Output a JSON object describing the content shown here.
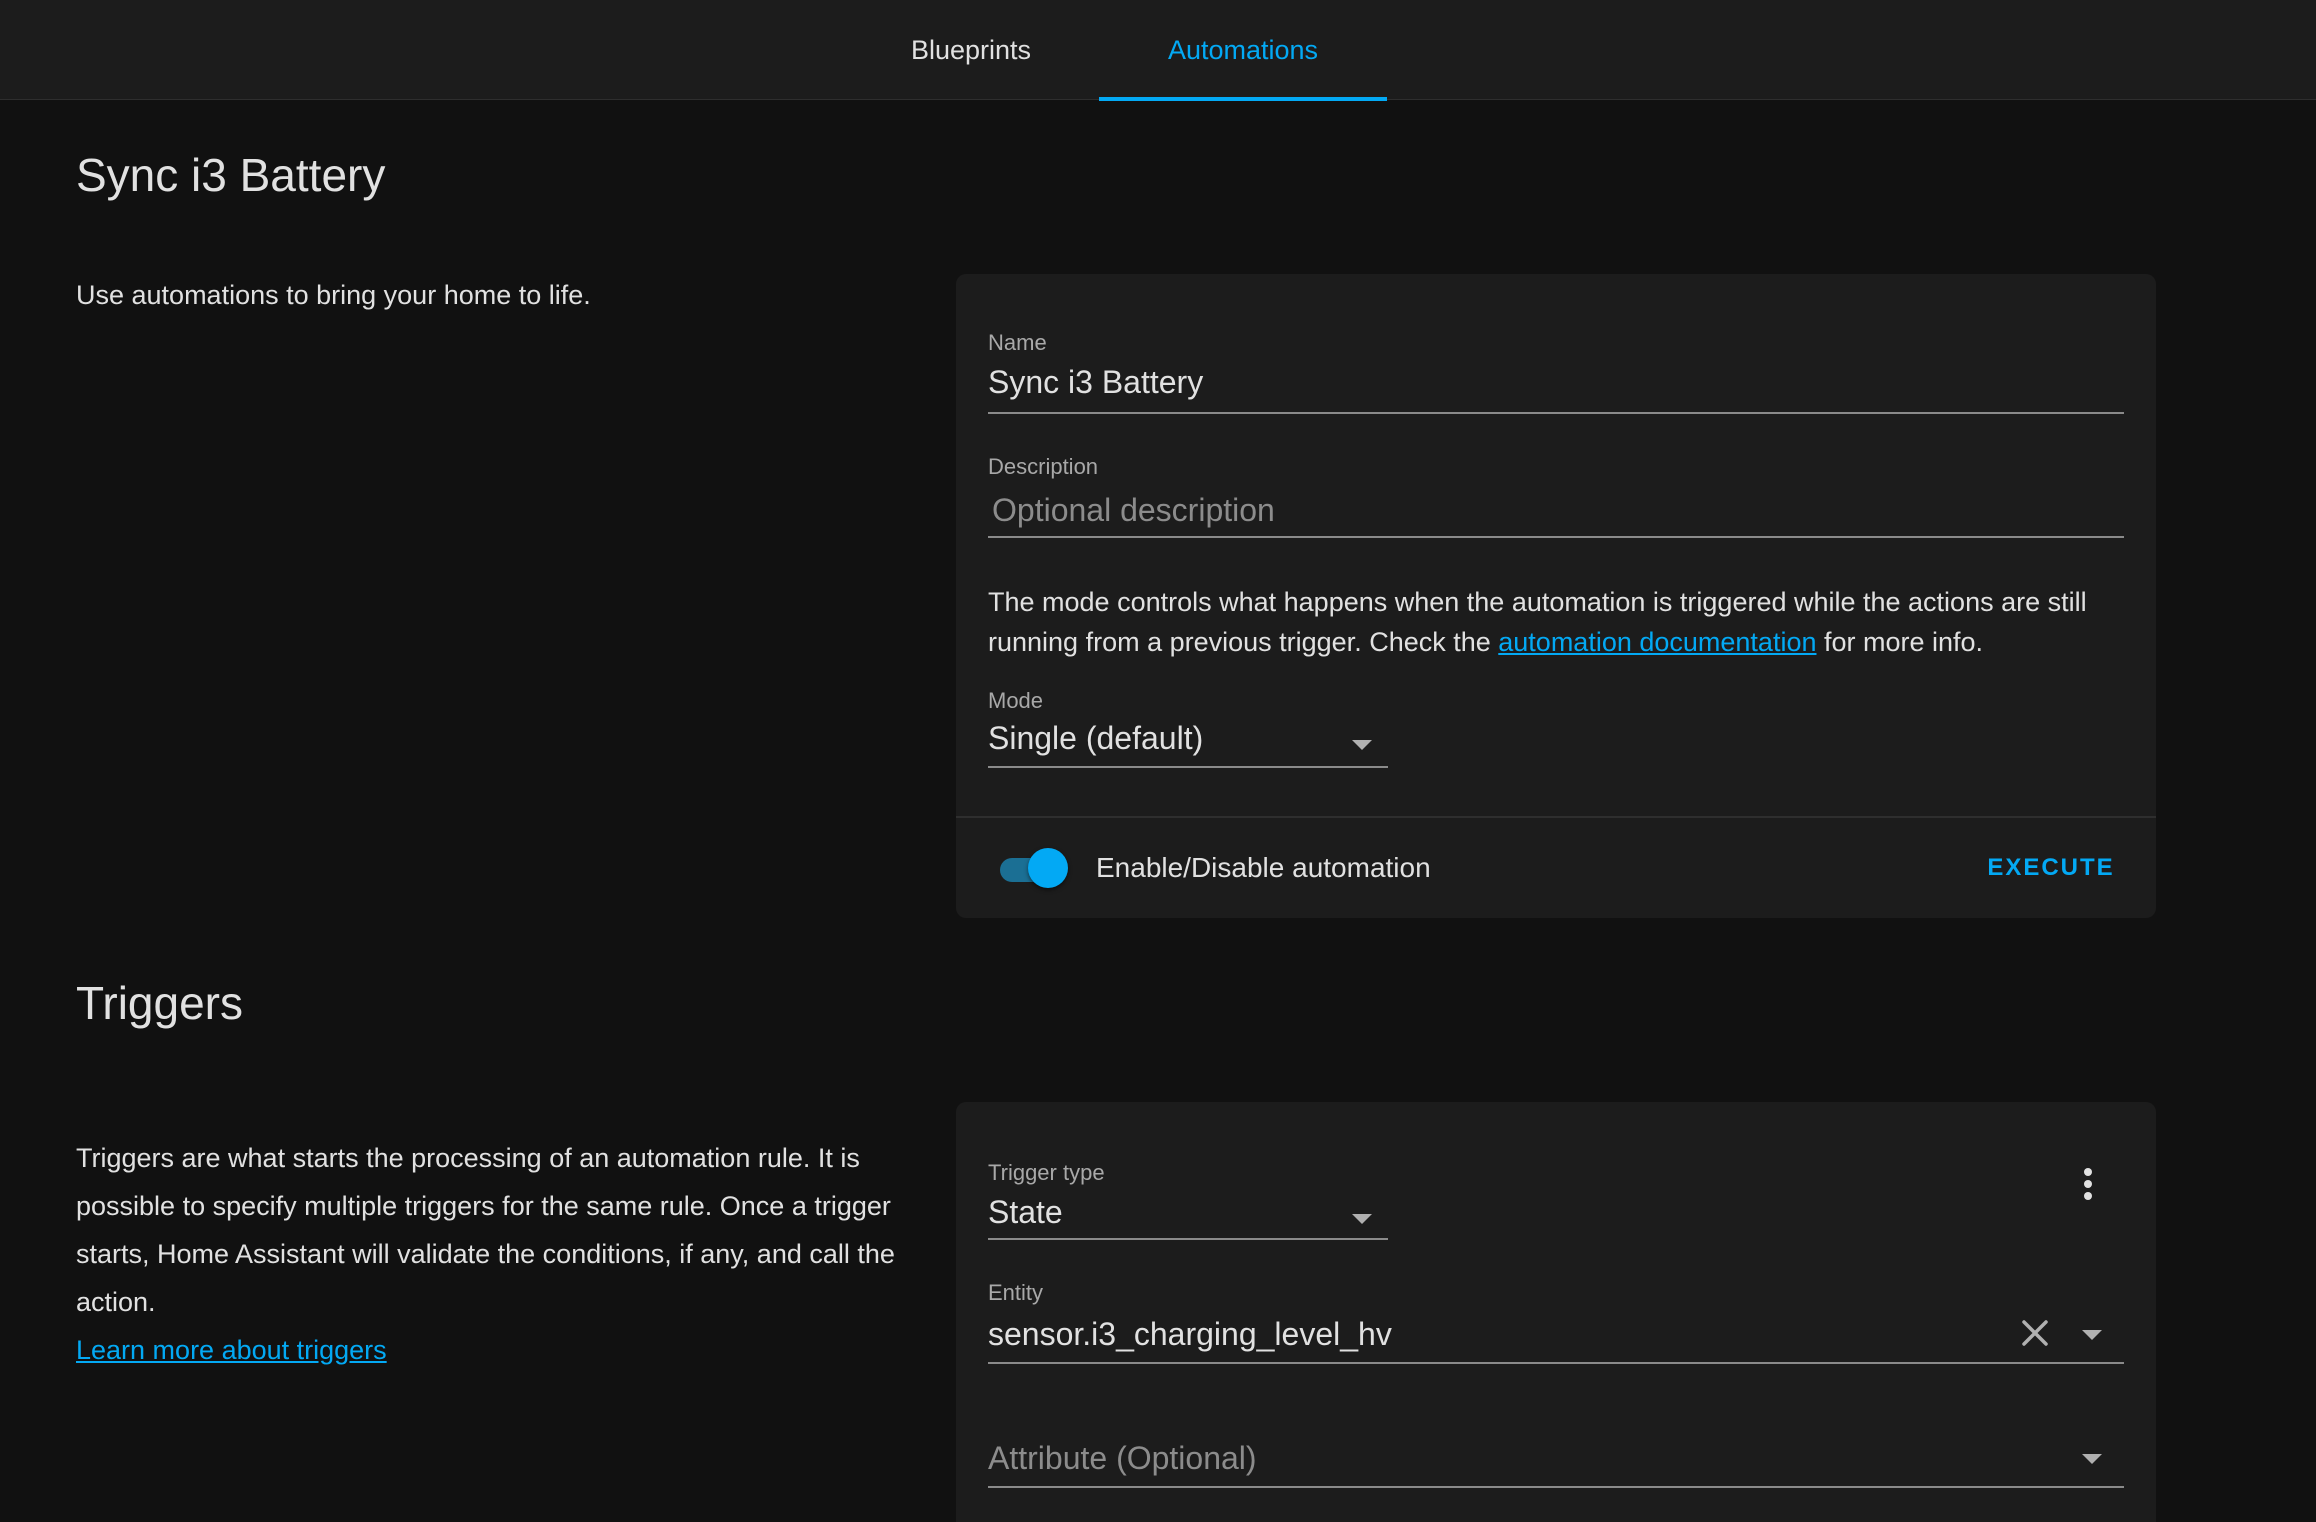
{
  "tabs": [
    {
      "label": "Blueprints",
      "active": false
    },
    {
      "label": "Automations",
      "active": true
    }
  ],
  "page_title": "Sync i3 Battery",
  "intro_text": "Use automations to bring your home to life.",
  "settings_card": {
    "name": {
      "label": "Name",
      "value": "Sync i3 Battery"
    },
    "description": {
      "label": "Description",
      "placeholder": "Optional description",
      "value": ""
    },
    "mode_help": {
      "before": "The mode controls what happens when the automation is triggered while the actions are still running from a previous trigger. Check the ",
      "link": "automation documentation",
      "after": " for more info."
    },
    "mode": {
      "label": "Mode",
      "value": "Single (default)"
    },
    "toggle": {
      "label": "Enable/Disable automation",
      "on": true
    },
    "execute_label": "EXECUTE"
  },
  "triggers_section": {
    "title": "Triggers",
    "description": "Triggers are what starts the processing of an automation rule. It is possible to specify multiple triggers for the same rule. Once a trigger starts, Home Assistant will validate the conditions, if any, and call the action.",
    "learn_more": "Learn more about triggers"
  },
  "trigger_card": {
    "trigger_type": {
      "label": "Trigger type",
      "value": "State"
    },
    "entity": {
      "label": "Entity",
      "value": "sensor.i3_charging_level_hv"
    },
    "attribute": {
      "placeholder": "Attribute (Optional)"
    }
  },
  "colors": {
    "accent": "#03a9f4",
    "background": "#111111",
    "card": "#1c1c1c",
    "text": "#e1e1e1",
    "muted": "#a8a8a8"
  },
  "icons": [
    "chevron-down-icon",
    "close-icon",
    "more-vertical-icon"
  ]
}
